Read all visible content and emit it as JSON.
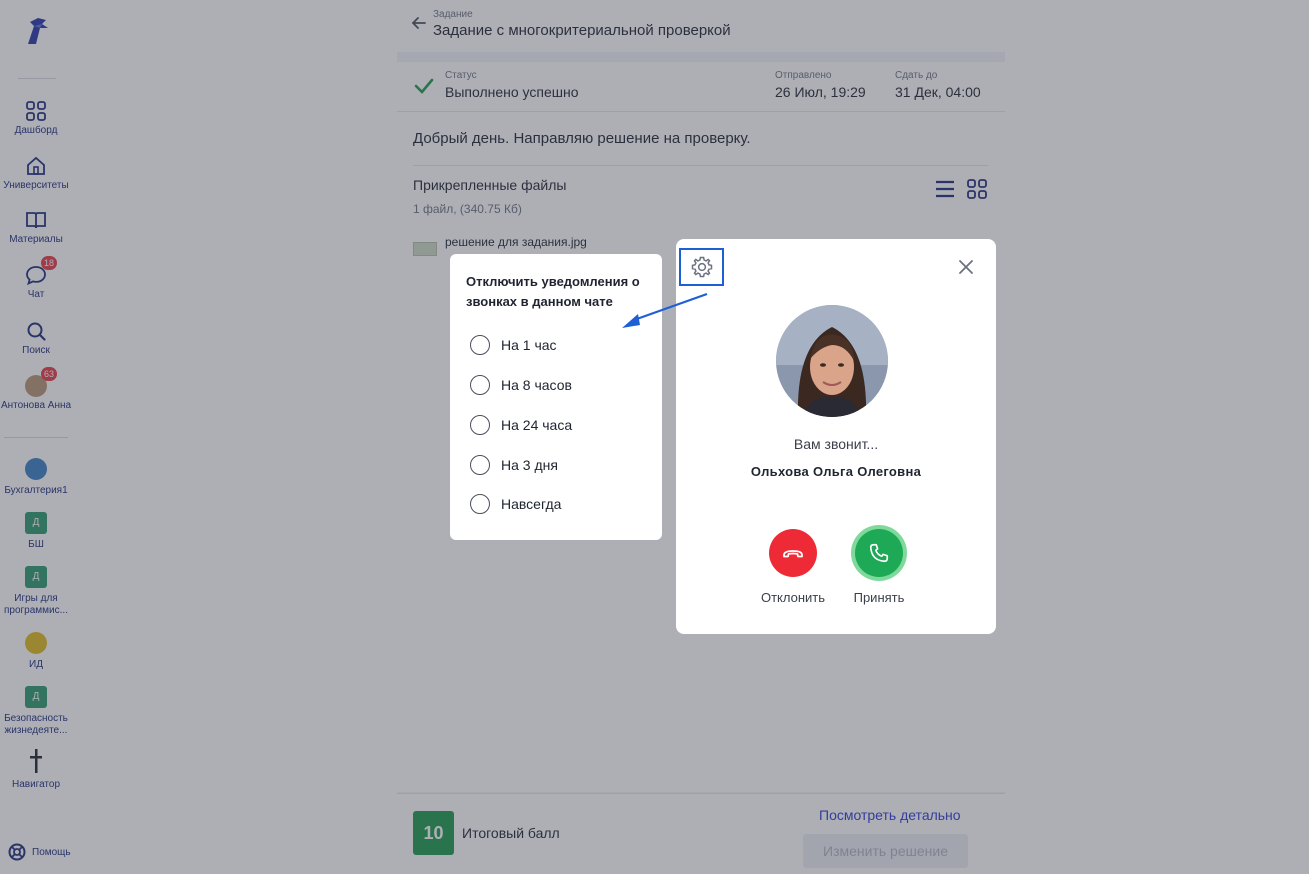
{
  "sidebar": {
    "items": [
      {
        "label": "Дашборд",
        "icon": "dashboard-icon"
      },
      {
        "label": "Университеты",
        "icon": "university-icon"
      },
      {
        "label": "Материалы",
        "icon": "book-icon"
      },
      {
        "label": "Чат",
        "icon": "chat-icon",
        "badge": "18"
      },
      {
        "label": "Поиск",
        "icon": "search-icon"
      },
      {
        "label": "Антонова Анна",
        "icon": "avatar",
        "badge": "63"
      }
    ],
    "channels": [
      {
        "label": "Бухгалтерия1",
        "kind": "round"
      },
      {
        "label": "БШ",
        "kind": "letter",
        "letter": "Д"
      },
      {
        "label": "Игры для программис...",
        "kind": "letter",
        "letter": "Д"
      },
      {
        "label": "ИД",
        "kind": "yellow"
      },
      {
        "label": "Безопасность жизнедеяте...",
        "kind": "letter",
        "letter": "Д"
      },
      {
        "label": "Навигатор",
        "kind": "cross"
      }
    ],
    "help_label": "Помощь"
  },
  "header": {
    "breadcrumb": "Задание",
    "title": "Задание с многокритериальной проверкой"
  },
  "status": {
    "status_label": "Статус",
    "status_value": "Выполнено успешно",
    "sent_label": "Отправлено",
    "sent_value": "26 Июл, 19:29",
    "due_label": "Сдать до",
    "due_value": "31 Дек, 04:00"
  },
  "message": "Добрый день. Направляю решение на проверку.",
  "files": {
    "title": "Прикрепленные файлы",
    "count": "1 файл, (340.75 Кб)",
    "items": [
      {
        "name": "решение для задания.jpg"
      }
    ]
  },
  "footer": {
    "score": "10",
    "score_label": "Итоговый балл",
    "detail_link": "Посмотреть детально",
    "change_button": "Изменить решение"
  },
  "mute_popover": {
    "title": "Отключить уведомления о звонках в данном чате",
    "options": [
      "На 1 час",
      "На 8 часов",
      "На 24 часа",
      "На 3 дня",
      "Навсегда"
    ]
  },
  "call": {
    "calling_text": "Вам звонит...",
    "caller_name": "Ольхова Ольга Олеговна",
    "decline_label": "Отклонить",
    "accept_label": "Принять",
    "colors": {
      "decline": "#ee2a37",
      "accept": "#1ea957",
      "highlight": "#1f5fd6"
    }
  }
}
